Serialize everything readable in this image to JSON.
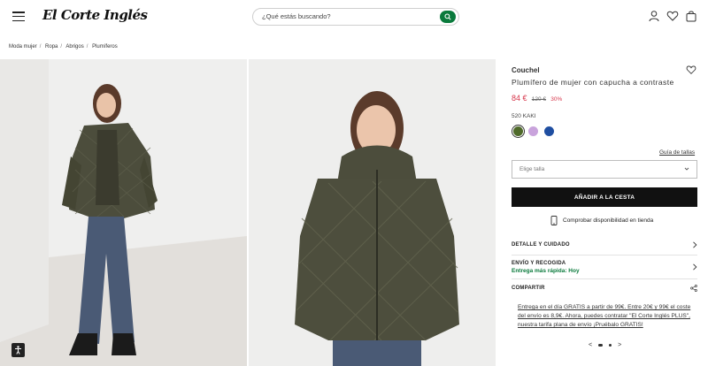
{
  "header": {
    "logo_text": "El Corte Inglés",
    "search_placeholder": "¿Qué estás buscando?"
  },
  "breadcrumb": [
    "Moda mujer",
    "Ropa",
    "Abrigos",
    "Plumíferos"
  ],
  "product": {
    "brand": "Couchel",
    "title": "Plumífero de mujer con capucha a contraste",
    "price_now": "84 €",
    "price_old": "120 €",
    "discount": "30%",
    "color_name": "520 KAKI",
    "swatches": [
      {
        "name": "kaki",
        "color": "#4f6a2a",
        "selected": true
      },
      {
        "name": "lila",
        "color": "#c9a3dc",
        "selected": false
      },
      {
        "name": "azul",
        "color": "#1f4ea1",
        "selected": false
      }
    ],
    "size_guide": "Guía de tallas",
    "size_placeholder": "Elige talla",
    "add_to_cart": "AÑADIR A LA CESTA",
    "stock_check": "Comprobar disponibilidad en tienda"
  },
  "accordion": {
    "details": "DETALLE Y CUIDADO",
    "shipping": "ENVÍO Y RECOGIDA",
    "shipping_sub": "Entrega más rápida: Hoy",
    "share": "COMPARTIR"
  },
  "promo_text": "Entrega en el día GRATIS a partir de 99€. Entre 20€ y 99€ el coste del envío es 8,9€. Ahora, puedes contratar \"El Corte Inglés PLUS\", nuestra tarifa plana de envío ¡Pruébalo GRATIS!",
  "pager": {
    "prev": "<",
    "next": ">"
  },
  "colors": {
    "brand_green": "#0a7a3c",
    "sale_red": "#d6364b",
    "button_black": "#111111"
  }
}
